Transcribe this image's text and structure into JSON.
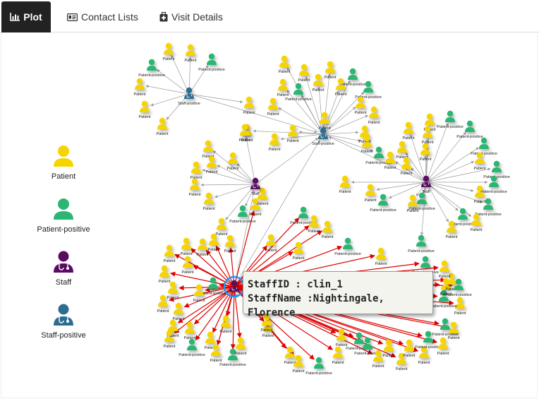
{
  "tabs": [
    {
      "label": "Plot",
      "icon": "bar-chart-icon",
      "active": true
    },
    {
      "label": "Contact Lists",
      "icon": "id-card-icon",
      "active": false
    },
    {
      "label": "Visit Details",
      "icon": "medkit-icon",
      "active": false
    }
  ],
  "legend": [
    {
      "label": "Patient",
      "icon": "patient-icon",
      "color": "#f5d400"
    },
    {
      "label": "Patient-positive",
      "icon": "patient-positive-icon",
      "color": "#2bb673"
    },
    {
      "label": "Staff",
      "icon": "staff-icon",
      "color": "#5b0a63"
    },
    {
      "label": "Staff-positive",
      "icon": "staff-positive-icon",
      "color": "#2e6d93"
    }
  ],
  "node_labels": {
    "patient": "Patient",
    "patient_positive": "Patient-positive",
    "staff": "Staff",
    "staff_positive": "Staff-positive"
  },
  "colors": {
    "patient": "#f5d400",
    "patient_positive": "#2bb673",
    "staff": "#5b0a63",
    "staff_positive": "#2e6d93",
    "edge": "#9a9a9a",
    "edge_highlight": "#e00000",
    "selection_ring": "#2196f3"
  },
  "tooltip": {
    "id_line": "StaffID : clin_1",
    "name_line": "StaffName :Nightingale, Florence"
  }
}
